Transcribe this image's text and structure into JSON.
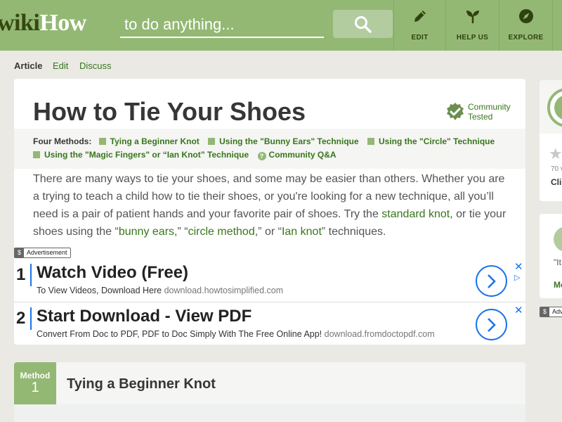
{
  "header": {
    "logo_wiki": "wiki",
    "logo_how": "How",
    "search_placeholder": "to do anything...",
    "search_icon": "search-icon",
    "nav": [
      {
        "label": "EDIT",
        "icon": "pencil-icon"
      },
      {
        "label": "HELP US",
        "icon": "sprout-icon"
      },
      {
        "label": "EXPLORE",
        "icon": "compass-icon"
      }
    ]
  },
  "tabs": {
    "article": "Article",
    "edit": "Edit",
    "discuss": "Discuss"
  },
  "article": {
    "title": "How to Tie Your Shoes",
    "community_line1": "Community",
    "community_line2": "Tested",
    "methods_label": "Four Methods:",
    "methods": [
      "Tying a Beginner Knot",
      "Using the \"Bunny Ears\" Technique",
      "Using the \"Circle\" Technique",
      "Using the \"Magic Fingers\" or “Ian Knot” Technique"
    ],
    "qa_label": "Community Q&A",
    "intro": {
      "t1": "There are many ways to tie your shoes, and some may be easier than others. Whether you are a trying to teach a child how to tie their shoes, or you're looking for a new technique, all you’ll need is a pair of patient hands and your favorite pair of shoes. Try the ",
      "l1": "standard knot",
      "t2": ", or tie your shoes using the “",
      "l2": "bunny ears",
      "t3": ",” “",
      "l3": "circle method",
      "t4": ",” or “",
      "l4": "Ian knot",
      "t5": "” techniques."
    }
  },
  "ads": {
    "label_icon": "$",
    "label": "Advertisement",
    "items": [
      {
        "num": "1",
        "title": "Watch Video (Free)",
        "desc": "To View Videos, Download Here",
        "url": "download.howtosimplified.com"
      },
      {
        "num": "2",
        "title": "Start Download - View PDF",
        "desc": "Convert From Doc to PDF, PDF to Doc Simply With The Free Online App!",
        "url": "download.fromdoctopdf.com"
      }
    ],
    "close": "✕",
    "choices": "▷"
  },
  "method": {
    "badge_label": "Method",
    "badge_num": "1",
    "title": "Tying a Beginner Knot"
  },
  "sidebar": {
    "star": "★",
    "count": "70 v",
    "click": "Cli",
    "quote": "\"It",
    "more": "Mo",
    "ad_label": "Adv"
  },
  "colors": {
    "header_green": "#93b874",
    "link_green": "#38761d",
    "ad_blue": "#1a73e8"
  }
}
